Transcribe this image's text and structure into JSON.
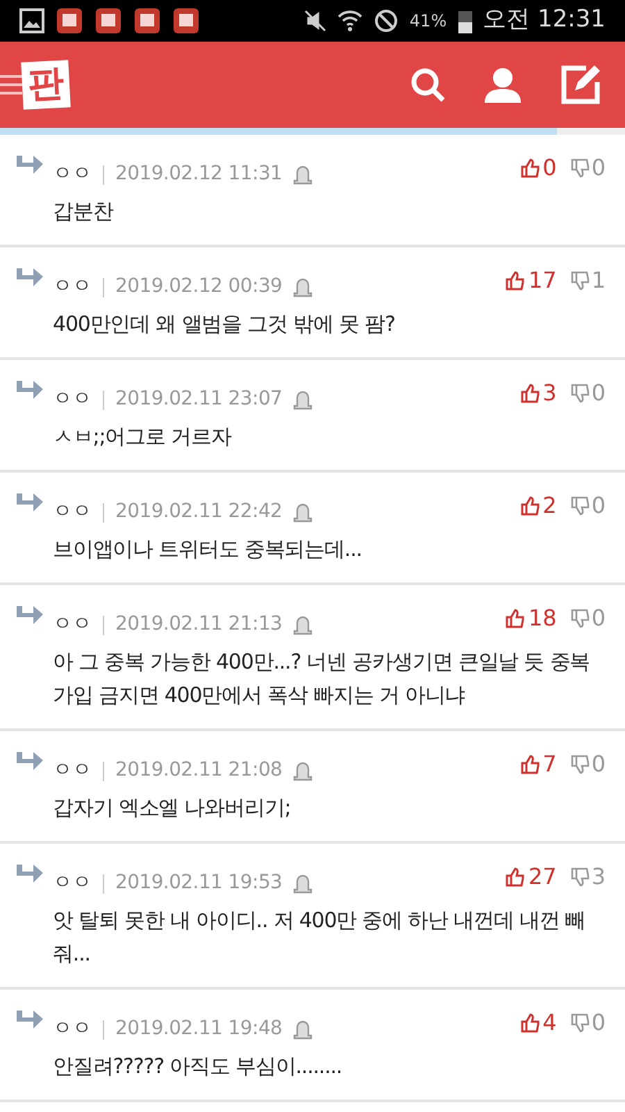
{
  "status_bar": {
    "battery": "41%",
    "time": "오전 12:31"
  },
  "header": {
    "logo": "판"
  },
  "progress": {
    "level": 0.89
  },
  "comments": [
    {
      "user": "ㅇㅇ",
      "date": "2019.02.12 11:31",
      "text": "갑분찬",
      "likes": "0",
      "dislikes": "0"
    },
    {
      "user": "ㅇㅇ",
      "date": "2019.02.12 00:39",
      "text": "400만인데 왜 앨범을 그것 밖에 못 팜?",
      "likes": "17",
      "dislikes": "1"
    },
    {
      "user": "ㅇㅇ",
      "date": "2019.02.11 23:07",
      "text": "ㅅㅂ;;어그로 거르자",
      "likes": "3",
      "dislikes": "0"
    },
    {
      "user": "ㅇㅇ",
      "date": "2019.02.11 22:42",
      "text": "브이앱이나 트위터도 중복되는데...",
      "likes": "2",
      "dislikes": "0"
    },
    {
      "user": "ㅇㅇ",
      "date": "2019.02.11 21:13",
      "text": "아 그 중복 가능한 400만...? 너넨 공카생기면 큰일날 듯 중복 가입 금지면 400만에서 폭삭 빠지는 거 아니냐",
      "likes": "18",
      "dislikes": "0"
    },
    {
      "user": "ㅇㅇ",
      "date": "2019.02.11 21:08",
      "text": "갑자기 엑소엘 나와버리기;",
      "likes": "7",
      "dislikes": "0"
    },
    {
      "user": "ㅇㅇ",
      "date": "2019.02.11 19:53",
      "text": "앗 탈퇴 못한 내 아이디.. 저 400만 중에 하난 내껀데 내껀 빼줘...",
      "likes": "27",
      "dislikes": "3"
    },
    {
      "user": "ㅇㅇ",
      "date": "2019.02.11 19:48",
      "text": "안질려????? 아직도 부심이........",
      "likes": "4",
      "dislikes": "0"
    }
  ]
}
